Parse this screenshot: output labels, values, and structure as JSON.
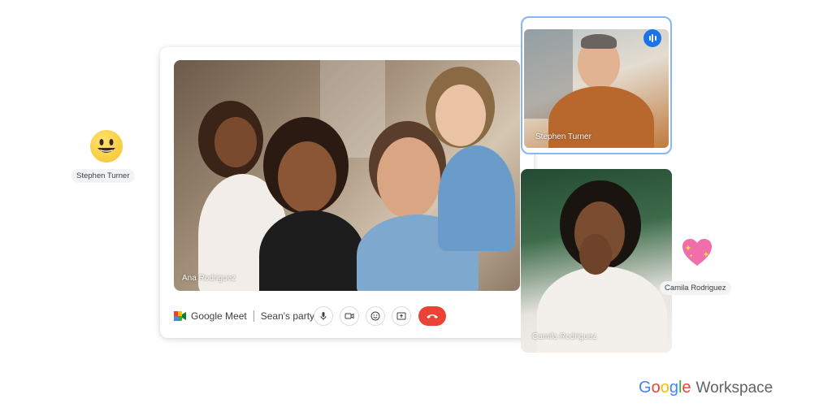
{
  "call": {
    "app_name": "Google Meet",
    "meeting_name": "Sean's party"
  },
  "participants": {
    "main": {
      "name": "Ana Rodriguez"
    },
    "top_right": {
      "name": "Stephen Turner",
      "speaking": true
    },
    "bottom_right": {
      "name": "Camila Rodriguez"
    }
  },
  "reactions": [
    {
      "name": "Stephen Turner",
      "icon": "smiley-emoji-icon"
    },
    {
      "name": "Camila Rodriguez",
      "icon": "sparkling-heart-emoji-icon"
    }
  ],
  "controls": [
    {
      "icon": "microphone-icon"
    },
    {
      "icon": "camera-icon"
    },
    {
      "icon": "emoji-icon"
    },
    {
      "icon": "present-screen-icon"
    },
    {
      "icon": "end-call-icon"
    }
  ],
  "brand": {
    "google": "Google",
    "workspace": "Workspace"
  },
  "colors": {
    "end_call": "#ea4335",
    "active_speaker_border": "#8ab4f8",
    "speaking_badge": "#1a73e8"
  }
}
